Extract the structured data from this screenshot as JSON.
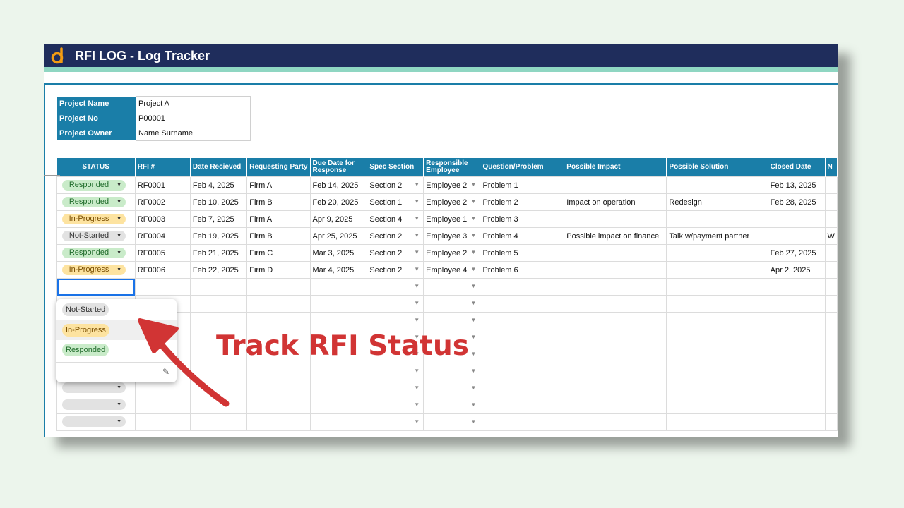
{
  "app": {
    "title": "RFI LOG - Log Tracker"
  },
  "project": {
    "rows": [
      {
        "label": "Project Name",
        "value": "Project A"
      },
      {
        "label": "Project No",
        "value": "P00001"
      },
      {
        "label": "Project Owner",
        "value": "Name Surname"
      }
    ]
  },
  "headers": {
    "status": "STATUS",
    "rfi": "RFI #",
    "date_received": "Date Recieved",
    "requesting_party": "Requesting Party",
    "due_date": "Due Date for Response",
    "spec_section": "Spec Section",
    "responsible": "Responsible Employee",
    "question": "Question/Problem",
    "impact": "Possible Impact",
    "solution": "Possible Solution",
    "closed": "Closed Date",
    "next": "N"
  },
  "rows": [
    {
      "status": "Responded",
      "rfi": "RF0001",
      "received": "Feb 4, 2025",
      "party": "Firm A",
      "due": "Feb 14, 2025",
      "section": "Section 2",
      "employee": "Employee 2",
      "question": "Problem 1",
      "impact": "",
      "solution": "",
      "closed": "Feb 13, 2025",
      "next": ""
    },
    {
      "status": "Responded",
      "rfi": "RF0002",
      "received": "Feb 10, 2025",
      "party": "Firm B",
      "due": "Feb 20, 2025",
      "section": "Section 1",
      "employee": "Employee 2",
      "question": "Problem 2",
      "impact": "Impact on operation",
      "solution": "Redesign",
      "closed": "Feb 28, 2025",
      "next": ""
    },
    {
      "status": "In-Progress",
      "rfi": "RF0003",
      "received": "Feb 7, 2025",
      "party": "Firm A",
      "due": "Apr 9, 2025",
      "section": "Section 4",
      "employee": "Employee 1",
      "question": "Problem 3",
      "impact": "",
      "solution": "",
      "closed": "",
      "next": ""
    },
    {
      "status": "Not-Started",
      "rfi": "RF0004",
      "received": "Feb 19, 2025",
      "party": "Firm B",
      "due": "Apr 25, 2025",
      "section": "Section 2",
      "employee": "Employee 3",
      "question": "Problem 4",
      "impact": "Possible impact on finance",
      "solution": "Talk w/payment partner",
      "closed": "",
      "next": "W"
    },
    {
      "status": "Responded",
      "rfi": "RF0005",
      "received": "Feb 21, 2025",
      "party": "Firm C",
      "due": "Mar 3, 2025",
      "section": "Section 2",
      "employee": "Employee 2",
      "question": "Problem 5",
      "impact": "",
      "solution": "",
      "closed": "Feb 27, 2025",
      "next": ""
    },
    {
      "status": "In-Progress",
      "rfi": "RF0006",
      "received": "Feb 22, 2025",
      "party": "Firm D",
      "due": "Mar 4, 2025",
      "section": "Section 2",
      "employee": "Employee 4",
      "question": "Problem 6",
      "impact": "",
      "solution": "",
      "closed": "Apr 2, 2025",
      "next": ""
    }
  ],
  "dropdown": {
    "options": [
      "Not-Started",
      "In-Progress",
      "Responded"
    ]
  },
  "annotation": {
    "text": "Track RFI Status"
  },
  "colors": {
    "header": "#1a7ea8",
    "titlebar": "#1f2d5c",
    "accent_bar": "#8fd6c2",
    "annotation": "#d13434",
    "responded": "#c9ebc9",
    "in_progress": "#fde3a0",
    "not_started": "#e2e2e2"
  }
}
